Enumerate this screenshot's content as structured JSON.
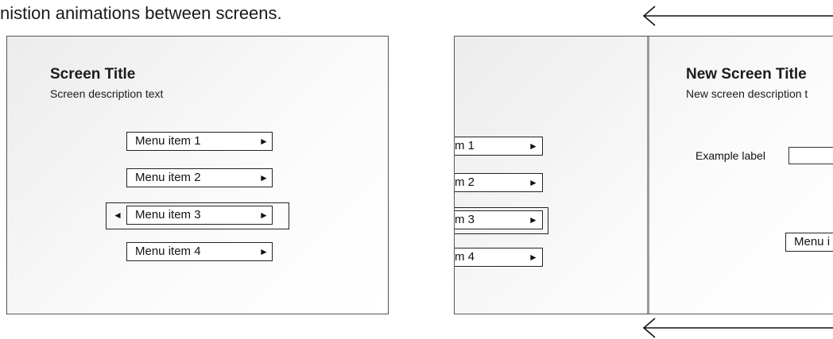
{
  "caption": "nistion animations between screens.",
  "screen1": {
    "title": "Screen Title",
    "description": "Screen description text",
    "menu": [
      {
        "label": "Menu item 1",
        "arrow": "►"
      },
      {
        "label": "Menu item 2",
        "arrow": "►"
      },
      {
        "label": "Menu item 3",
        "arrow": "►",
        "selected": true,
        "left_arrow": "◄"
      },
      {
        "label": "Menu item 4",
        "arrow": "►"
      }
    ]
  },
  "screen2": {
    "outgoing_menu": [
      {
        "label": "m 1",
        "arrow": "►"
      },
      {
        "label": "m 2",
        "arrow": "►"
      },
      {
        "label": "m 3",
        "arrow": "►",
        "selected": true
      },
      {
        "label": "m 4",
        "arrow": "►"
      }
    ],
    "title": "New Screen Title",
    "description": "New screen description t",
    "field_label": "Example label",
    "menu_item_partial": "Menu i"
  },
  "colors": {
    "border": "#555555",
    "divider": "#9a9a9a",
    "arrow": "#111111"
  }
}
